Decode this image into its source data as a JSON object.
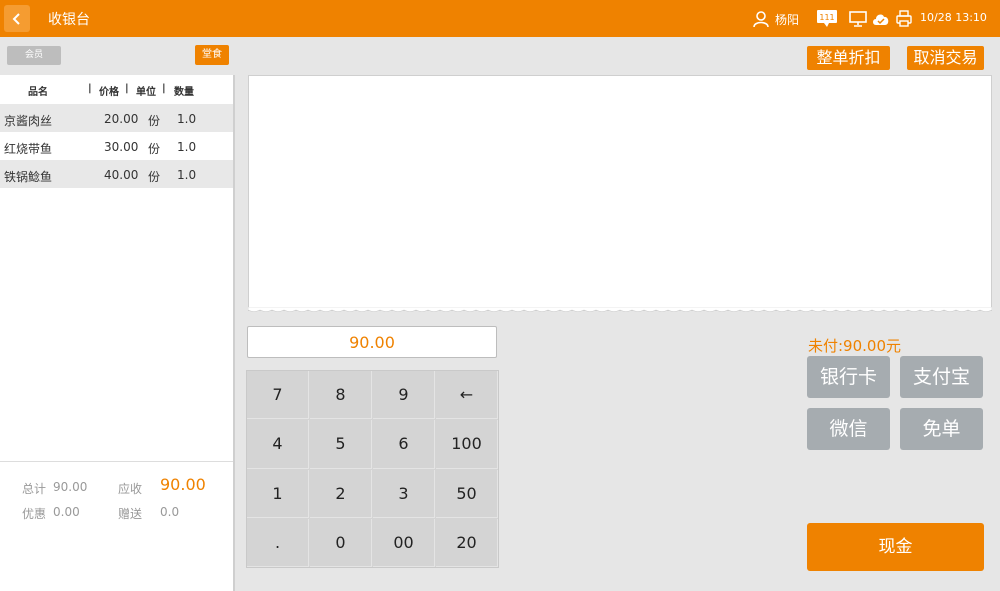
{
  "header": {
    "title": "收银台",
    "user": "杨阳",
    "message_badge": "111",
    "datetime": "10/28 13:10"
  },
  "left_controls": {
    "member_label": "会员",
    "dine_in_label": "堂食"
  },
  "order_table": {
    "columns": [
      "品名",
      "价格",
      "单位",
      "数量"
    ],
    "rows": [
      {
        "name": "京酱肉丝",
        "price": "20.00",
        "unit": "份",
        "qty": "1.0"
      },
      {
        "name": "红烧带鱼",
        "price": "30.00",
        "unit": "份",
        "qty": "1.0"
      },
      {
        "name": "铁锅鲶鱼",
        "price": "40.00",
        "unit": "份",
        "qty": "1.0"
      }
    ]
  },
  "totals": {
    "total_label": "总计",
    "total_value": "90.00",
    "receivable_label": "应收",
    "receivable_value": "90.00",
    "discount_label": "优惠",
    "discount_value": "0.00",
    "gift_label": "赠送",
    "gift_value": "0.0"
  },
  "actions": {
    "whole_discount": "整单折扣",
    "cancel_transaction": "取消交易"
  },
  "amount_input": {
    "value": "90.00"
  },
  "keypad": [
    "7",
    "8",
    "9",
    "←",
    "4",
    "5",
    "6",
    "100",
    "1",
    "2",
    "3",
    "50",
    ".",
    "0",
    "00",
    "20"
  ],
  "payment": {
    "unpaid_text": "未付:90.00元",
    "bank_card": "银行卡",
    "alipay": "支付宝",
    "wechat": "微信",
    "free": "免单",
    "cash": "现金"
  },
  "colors": {
    "accent": "#ef8200",
    "pay_button_gray": "#a6acb0",
    "background": "#e6e6e6"
  }
}
